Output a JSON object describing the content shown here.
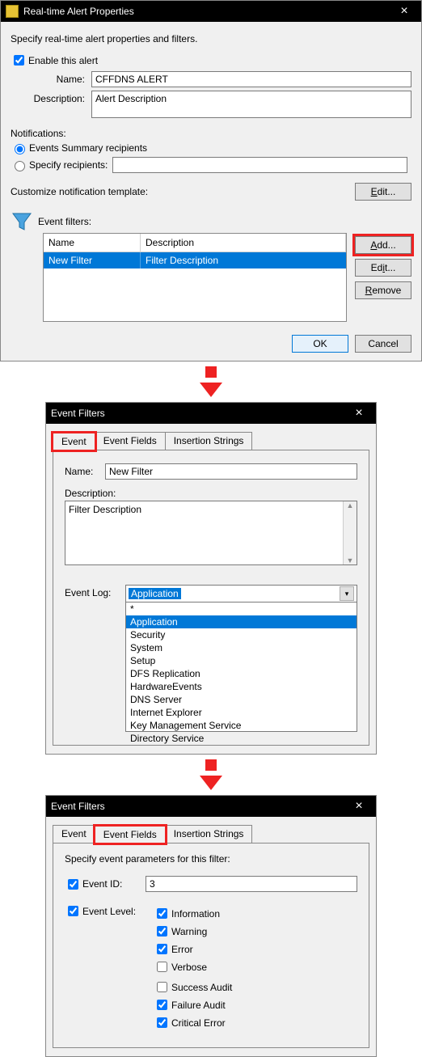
{
  "dialog1": {
    "title": "Real-time Alert Properties",
    "instruction": "Specify real-time alert properties and filters.",
    "enable_label": "Enable this alert",
    "enable_checked": true,
    "name_label": "Name:",
    "name_value": "CFFDNS ALERT",
    "desc_label": "Description:",
    "desc_value": "Alert Description",
    "notifications_label": "Notifications:",
    "radio_summary": "Events Summary recipients",
    "radio_specify": "Specify recipients:",
    "specify_value": "",
    "customize_label": "Customize notification template:",
    "edit_btn": "Edit...",
    "event_filters_label": "Event filters:",
    "table": {
      "col_name": "Name",
      "col_desc": "Description",
      "rows": [
        {
          "name": "New Filter",
          "desc": "Filter Description"
        }
      ]
    },
    "btn_add": "Add...",
    "btn_edit": "Edit...",
    "btn_remove": "Remove",
    "btn_ok": "OK",
    "btn_cancel": "Cancel"
  },
  "dialog2": {
    "title": "Event Filters",
    "tabs": {
      "event": "Event",
      "fields": "Event Fields",
      "strings": "Insertion Strings"
    },
    "name_label": "Name:",
    "name_value": "New Filter",
    "desc_label": "Description:",
    "desc_value": "Filter Description",
    "eventlog_label": "Event Log:",
    "eventlog_selected": "Application",
    "eventlog_options": [
      "*",
      "Application",
      "Security",
      "System",
      "Setup",
      "DFS Replication",
      "HardwareEvents",
      "DNS Server",
      "Internet Explorer",
      "Key Management Service",
      "Directory Service"
    ]
  },
  "dialog3": {
    "title": "Event Filters",
    "tabs": {
      "event": "Event",
      "fields": "Event Fields",
      "strings": "Insertion Strings"
    },
    "instruction": "Specify event parameters for this filter:",
    "eventid_label": "Event ID:",
    "eventid_checked": true,
    "eventid_value": "3",
    "eventlevel_label": "Event Level:",
    "eventlevel_checked": true,
    "levels": {
      "information": "Information",
      "warning": "Warning",
      "error": "Error",
      "verbose": "Verbose",
      "success": "Success Audit",
      "failure": "Failure Audit",
      "critical": "Critical Error"
    },
    "checked": {
      "information": true,
      "warning": true,
      "error": true,
      "verbose": false,
      "success": false,
      "failure": true,
      "critical": true
    }
  }
}
